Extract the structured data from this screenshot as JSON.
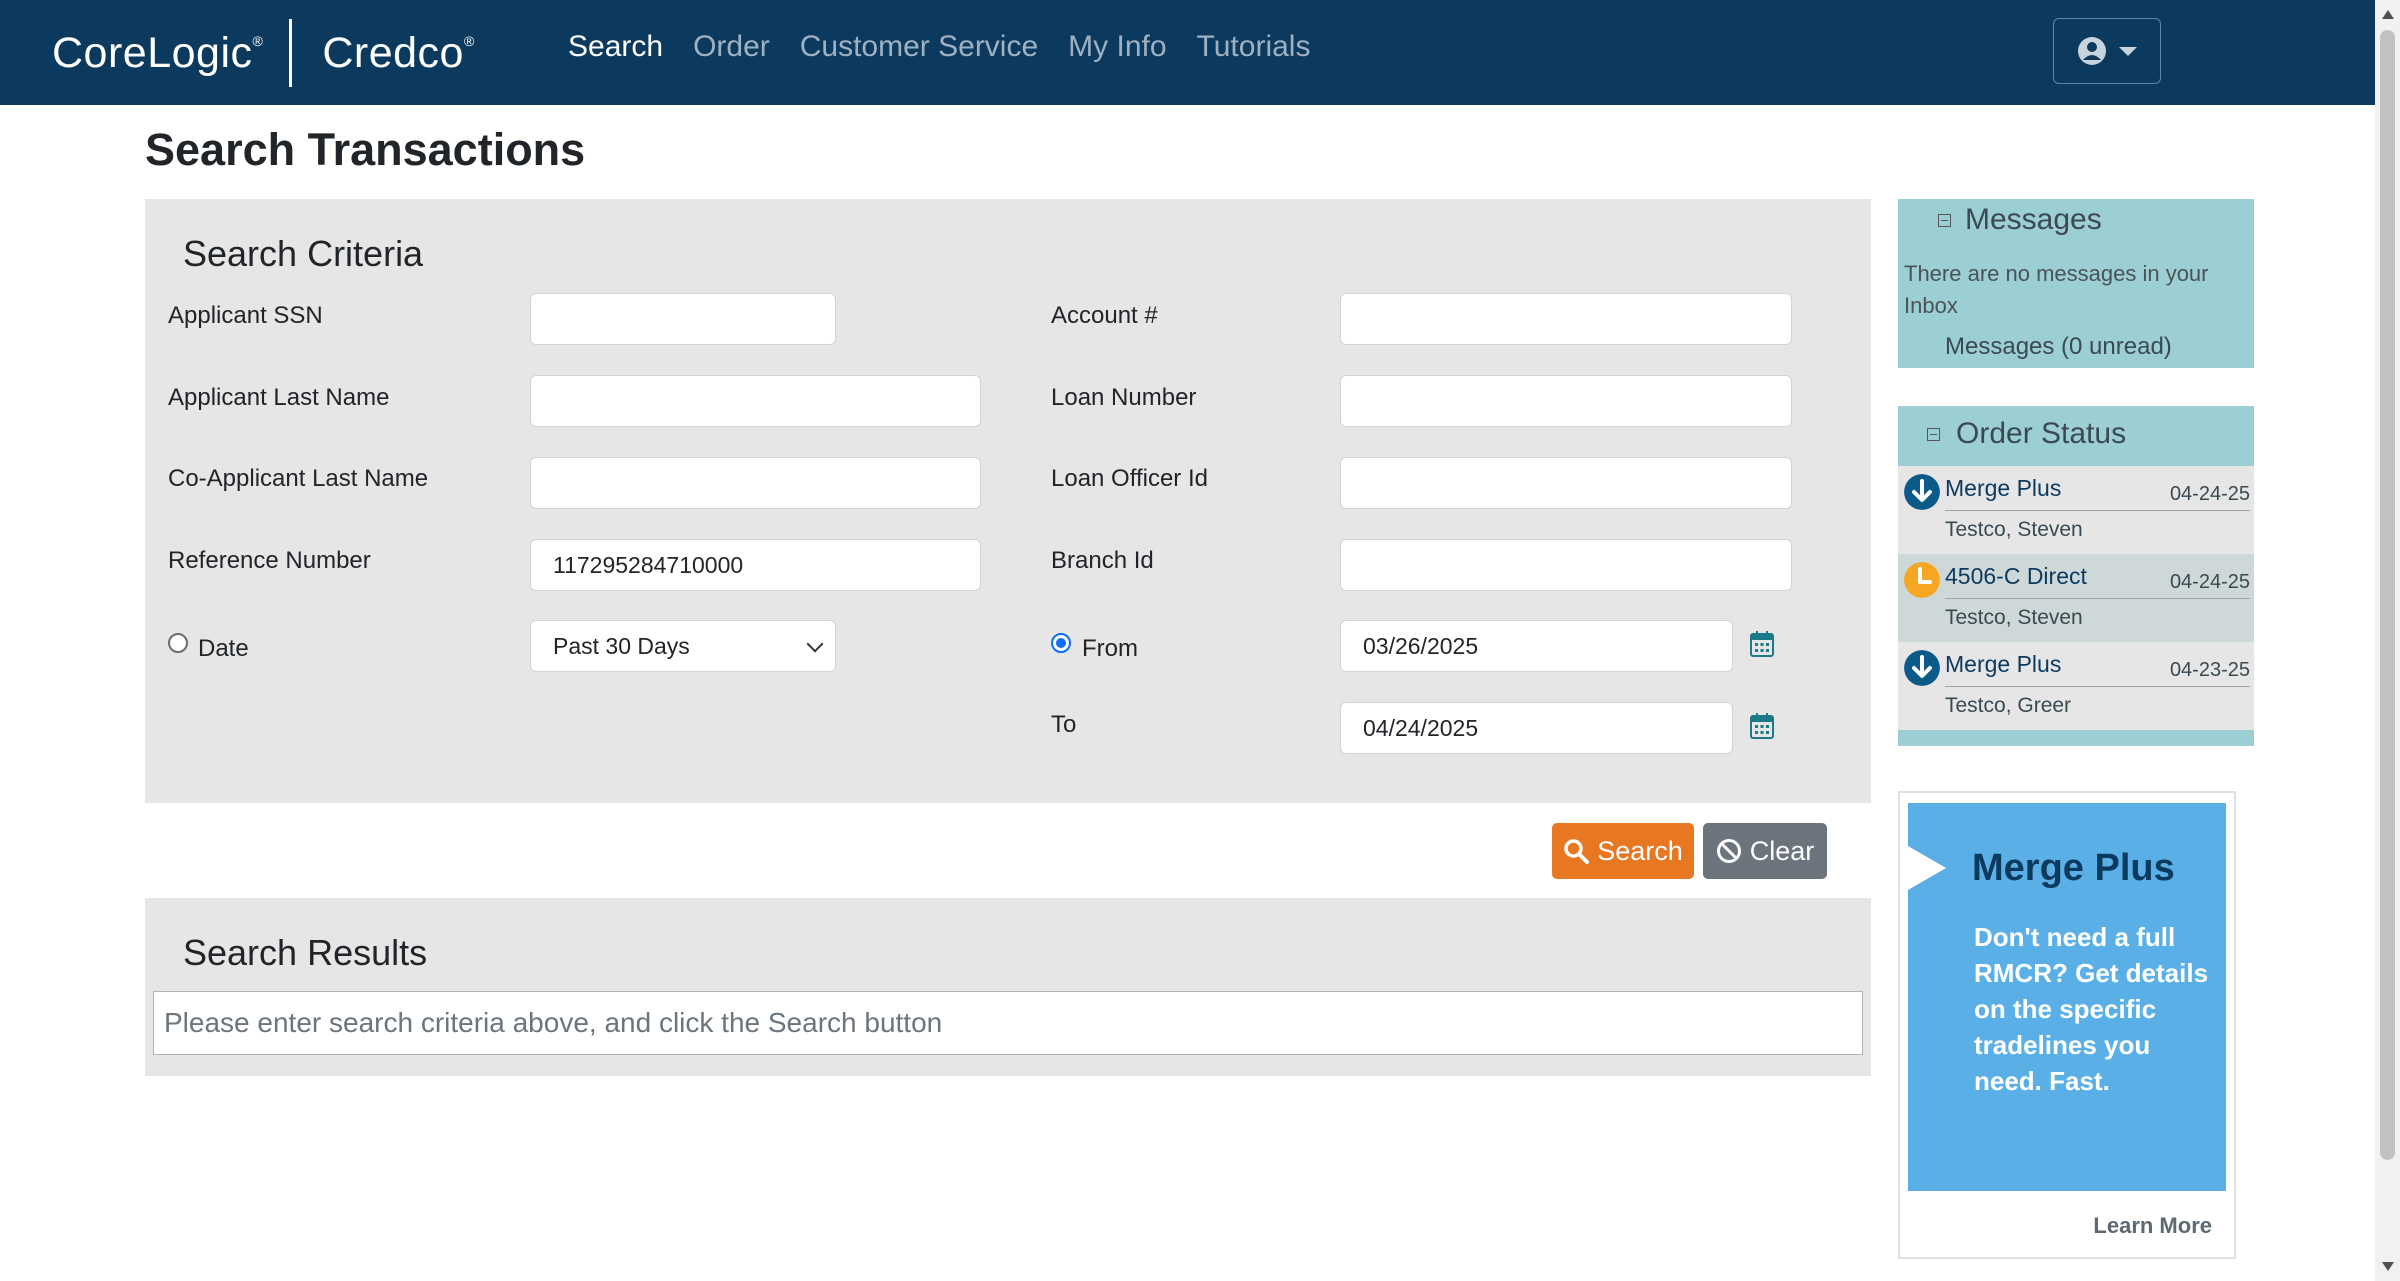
{
  "brand": {
    "primary": "CoreLogic",
    "secondary": "Credco",
    "reg": "®"
  },
  "nav": {
    "items": [
      "Search",
      "Order",
      "Customer Service",
      "My Info",
      "Tutorials"
    ],
    "active": "Search"
  },
  "page": {
    "title": "Search Transactions"
  },
  "criteria": {
    "title": "Search Criteria",
    "applicant_ssn": {
      "label": "Applicant SSN",
      "value": ""
    },
    "applicant_last_name": {
      "label": "Applicant Last Name",
      "value": ""
    },
    "coapplicant_last_name": {
      "label": "Co-Applicant Last Name",
      "value": ""
    },
    "reference_number": {
      "label": "Reference Number",
      "value": "117295284710000"
    },
    "date": {
      "label": "Date",
      "selected": "Past 30 Days",
      "checked": false
    },
    "account": {
      "label": "Account #",
      "value": ""
    },
    "loan_number": {
      "label": "Loan Number",
      "value": ""
    },
    "loan_officer_id": {
      "label": "Loan Officer Id",
      "value": ""
    },
    "branch_id": {
      "label": "Branch Id",
      "value": ""
    },
    "from": {
      "label": "From",
      "value": "03/26/2025",
      "checked": true
    },
    "to": {
      "label": "To",
      "value": "04/24/2025"
    }
  },
  "buttons": {
    "search": "Search",
    "clear": "Clear"
  },
  "results": {
    "title": "Search Results",
    "placeholder": "Please enter search criteria above, and click the Search button"
  },
  "messages": {
    "title": "Messages",
    "empty_text": "There are no messages in your Inbox",
    "link": "Messages (0 unread)"
  },
  "order_status": {
    "title": "Order Status",
    "items": [
      {
        "product": "Merge Plus",
        "date": "04-24-25",
        "name": "Testco, Steven",
        "status_icon": "download-arrow-icon",
        "color": "#0c5a8a"
      },
      {
        "product": "4506-C Direct",
        "date": "04-24-25",
        "name": "Testco, Steven",
        "status_icon": "clock-pending-icon",
        "color": "#f5a623"
      },
      {
        "product": "Merge Plus",
        "date": "04-23-25",
        "name": "Testco, Greer",
        "status_icon": "download-arrow-icon",
        "color": "#0c5a8a"
      }
    ]
  },
  "ad": {
    "title": "Merge Plus",
    "body": "Don't need a full RMCR? Get details on the specific tradelines you need. Fast.",
    "link": "Learn More"
  },
  "colors": {
    "nav_bg": "#0c3a5e",
    "accent": "#e87722",
    "panel": "#e6e6e6",
    "sidebar": "#9ccfd3"
  }
}
